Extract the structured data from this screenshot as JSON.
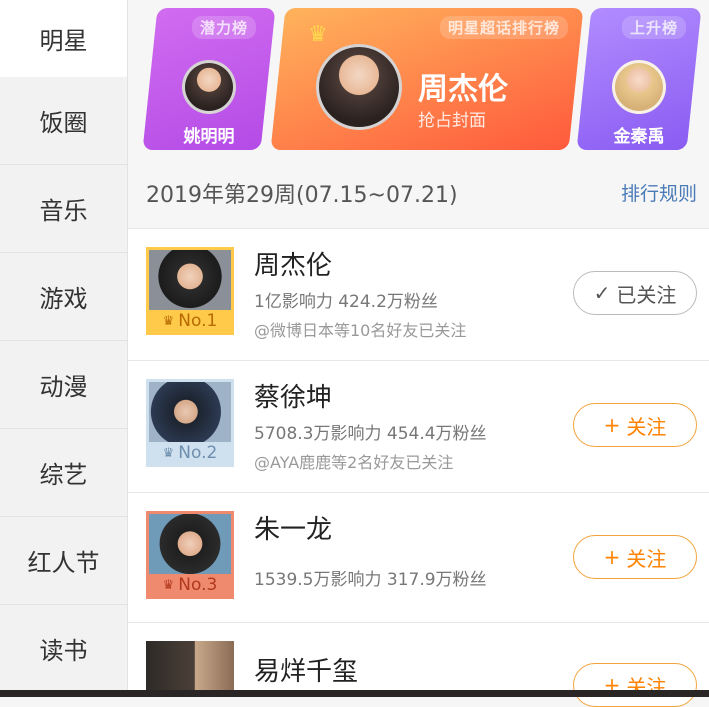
{
  "sidebar": {
    "items": [
      {
        "label": "明星",
        "active": true
      },
      {
        "label": "饭圈"
      },
      {
        "label": "音乐"
      },
      {
        "label": "游戏"
      },
      {
        "label": "动漫"
      },
      {
        "label": "综艺"
      },
      {
        "label": "红人节"
      },
      {
        "label": "读书"
      }
    ]
  },
  "banner": {
    "left": {
      "tag": "潜力榜",
      "name": "姚明明"
    },
    "middle": {
      "tag": "明星超话排行榜",
      "name": "周杰伦",
      "subtitle": "抢占封面"
    },
    "right": {
      "tag": "上升榜",
      "name": "金秦禹"
    }
  },
  "week": {
    "title": "2019年第29周(07.15~07.21)",
    "rule_link": "排行规则"
  },
  "rankings": [
    {
      "rank": "No.1",
      "name": "周杰伦",
      "stats": "1亿影响力 424.2万粉丝",
      "friends": "@微博日本等10名好友已关注",
      "button": "已关注",
      "followed": true
    },
    {
      "rank": "No.2",
      "name": "蔡徐坤",
      "stats": "5708.3万影响力 454.4万粉丝",
      "friends": "@AYA鹿鹿等2名好友已关注",
      "button": "关注",
      "followed": false
    },
    {
      "rank": "No.3",
      "name": "朱一龙",
      "stats": "1539.5万影响力 317.9万粉丝",
      "friends": "",
      "button": "关注",
      "followed": false
    },
    {
      "rank": "",
      "name": "易烊千玺",
      "stats": "",
      "friends": "",
      "button": "关注",
      "followed": false
    }
  ],
  "colors": {
    "accent_orange": "#ff8200",
    "link_blue": "#4a7bb7",
    "gold_frame": "#ffc94a",
    "silver_frame": "#cfe0ef",
    "bronze_frame": "#f08a6e"
  },
  "icons": {
    "check": "check-icon",
    "plus": "plus-icon",
    "crown": "crown-icon"
  }
}
